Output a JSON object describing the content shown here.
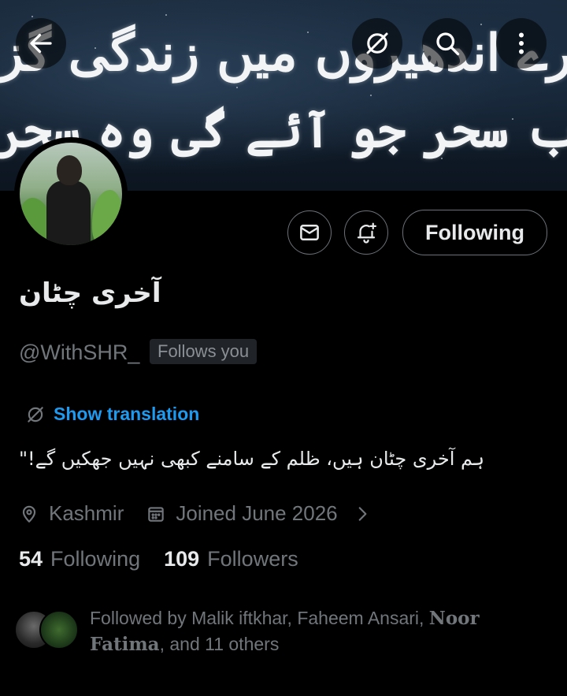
{
  "banner": {
    "line1": "رے اندھیروں میں زندگی گزار",
    "line2": "ب سحر جو آئے گی وہ سحر ہمارا ہے"
  },
  "header": {
    "back_icon": "arrow-left-icon",
    "translate_icon": "translate-off-icon",
    "search_icon": "search-icon",
    "more_icon": "more-vertical-icon"
  },
  "actions": {
    "message_icon": "envelope-icon",
    "notify_icon": "bell-plus-icon",
    "following_label": "Following"
  },
  "profile": {
    "display_name": "آخری چٹان",
    "handle": "@WithSHR_",
    "follows_you": "Follows you",
    "show_translation": "Show translation",
    "bio": "ہم آخری چٹان ہیں، ظلم کے سامنے کبھی نہیں جھکیں گے!\"",
    "location": "Kashmir",
    "joined": "Joined June 2026",
    "following_count": "54",
    "following_label": "Following",
    "followers_count": "109",
    "followers_label": "Followers"
  },
  "followed_by": {
    "prefix": "Followed by Malik iftkhar, Faheem Ansari, ",
    "serif_name": "Noor Fatima",
    "suffix": ", and 11 others"
  },
  "colors": {
    "background": "#000000",
    "accent": "#1d9bf0",
    "muted": "#71767b",
    "text": "#e7e9ea"
  }
}
